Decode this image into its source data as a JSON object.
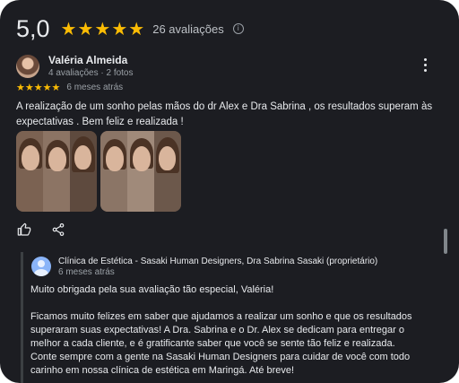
{
  "summary": {
    "rating": "5,0",
    "stars": 5,
    "review_count": "26 avaliações"
  },
  "review": {
    "reviewer_name": "Valéria Almeida",
    "reviewer_meta": "4 avaliações · 2 fotos",
    "stars": 5,
    "date": "6 meses atrás",
    "text": "A realização de um sonho pelas mãos do dr Alex e Dra Sabrina , os resultados superam às expectativas . Bem feliz e realizada !",
    "photo_count": 2
  },
  "icons": {
    "more": "more-vert-icon",
    "like": "thumb-up-icon",
    "share": "share-icon",
    "info": "info-icon"
  },
  "reply": {
    "owner_name": "Clínica de Estética - Sasaki Human Designers, Dra Sabrina Sasaki (proprietário)",
    "date": "6 meses atrás",
    "paragraph_1": "Muito obrigada pela sua avaliação tão especial, Valéria!",
    "paragraph_2": "Ficamos muito felizes em saber que ajudamos a realizar um sonho e que os resultados superaram suas expectativas! A Dra. Sabrina e o Dr. Alex se dedicam para entregar o melhor a cada cliente, e é gratificante saber que você se sente tão feliz e realizada. Conte sempre com a gente na Sasaki Human Designers para cuidar de você com todo carinho em nossa clínica de estética em Maringá. Até breve!"
  },
  "colors": {
    "background": "#1c1d22",
    "star": "#fbbc04",
    "text": "#e8eaed",
    "muted": "#9aa0a6",
    "owner_avatar": "#8ab4f8"
  }
}
